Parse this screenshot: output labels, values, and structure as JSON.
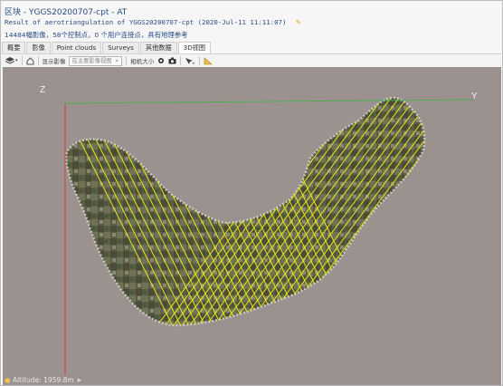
{
  "window": {
    "title": "区块 - YGGS20200707-cpt - AT",
    "result_line": "Result of aerotriangulation of YGGS20200707-cpt (2020-Jul-11 11:11:07)",
    "summary_line": "14484幅影像，58个控制点，0 个用户连接点，具有地理参考"
  },
  "tabs": [
    {
      "label": "概要",
      "active": false
    },
    {
      "label": "影像",
      "active": false
    },
    {
      "label": "Point clouds",
      "active": false
    },
    {
      "label": "Surveys",
      "active": false
    },
    {
      "label": "其他数据",
      "active": false
    },
    {
      "label": "3D视图",
      "active": true
    }
  ],
  "toolbar": {
    "layers_icon": "layers-icon",
    "home_icon": "home-icon",
    "show_images_label": "显示影像",
    "show_images_select": "在主要影像视图",
    "camera_size_label": "相机大小",
    "eye_icon": "eye-icon",
    "camera_icon": "camera-icon",
    "pick_icon": "pick-icon",
    "measure_icon": "ruler-icon"
  },
  "viewport": {
    "axis_z": "Z",
    "axis_y": "Y",
    "flight_line_color": "#e9e41e",
    "x_axis_color": "#d33b3b",
    "y_axis_color": "#4caf50"
  },
  "status": {
    "altitude": "Altitude: 1959.8m"
  }
}
